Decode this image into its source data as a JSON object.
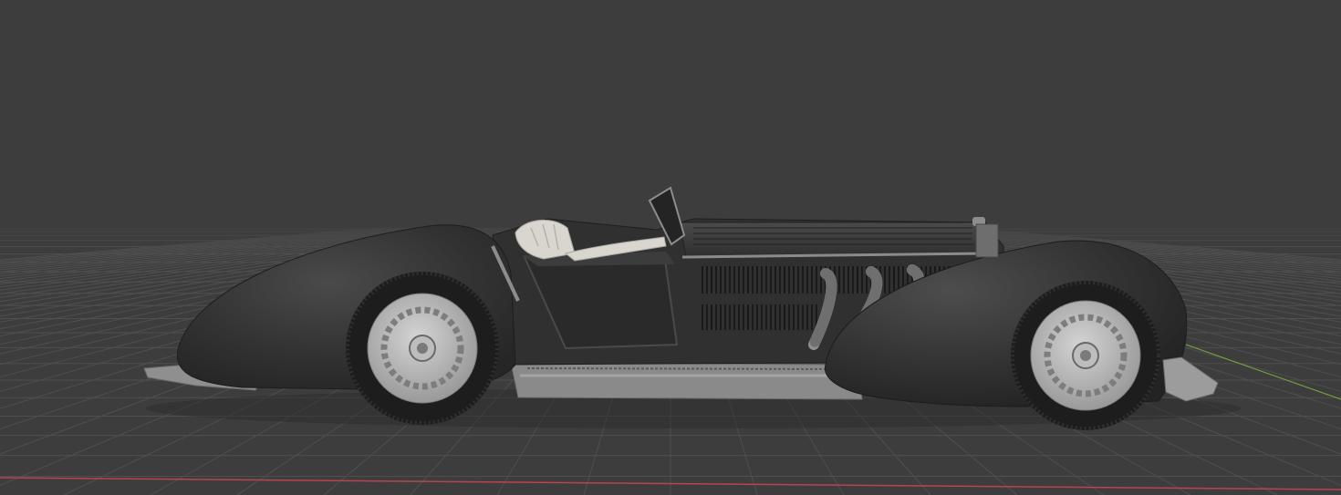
{
  "viewport": {
    "mode": "3d-viewport",
    "view": "side",
    "shading": "solid",
    "show_grid_floor": true,
    "show_x_axis": true,
    "show_y_axis": true,
    "colors": {
      "background": "#3d3d3d",
      "grid": "#4f4f4f",
      "x_axis": "#b8454c",
      "y_axis": "#6f9c3d"
    }
  },
  "model": {
    "object": "vintage-roadster",
    "icon": "car-icon",
    "colors": {
      "body": "#2e2e2e",
      "body_highlight": "#474747",
      "wheel_cover": "#bdbdbd",
      "tire": "#1c1c1c",
      "interior": "#d9d6cf",
      "chrome": "#9c9c9c"
    }
  }
}
